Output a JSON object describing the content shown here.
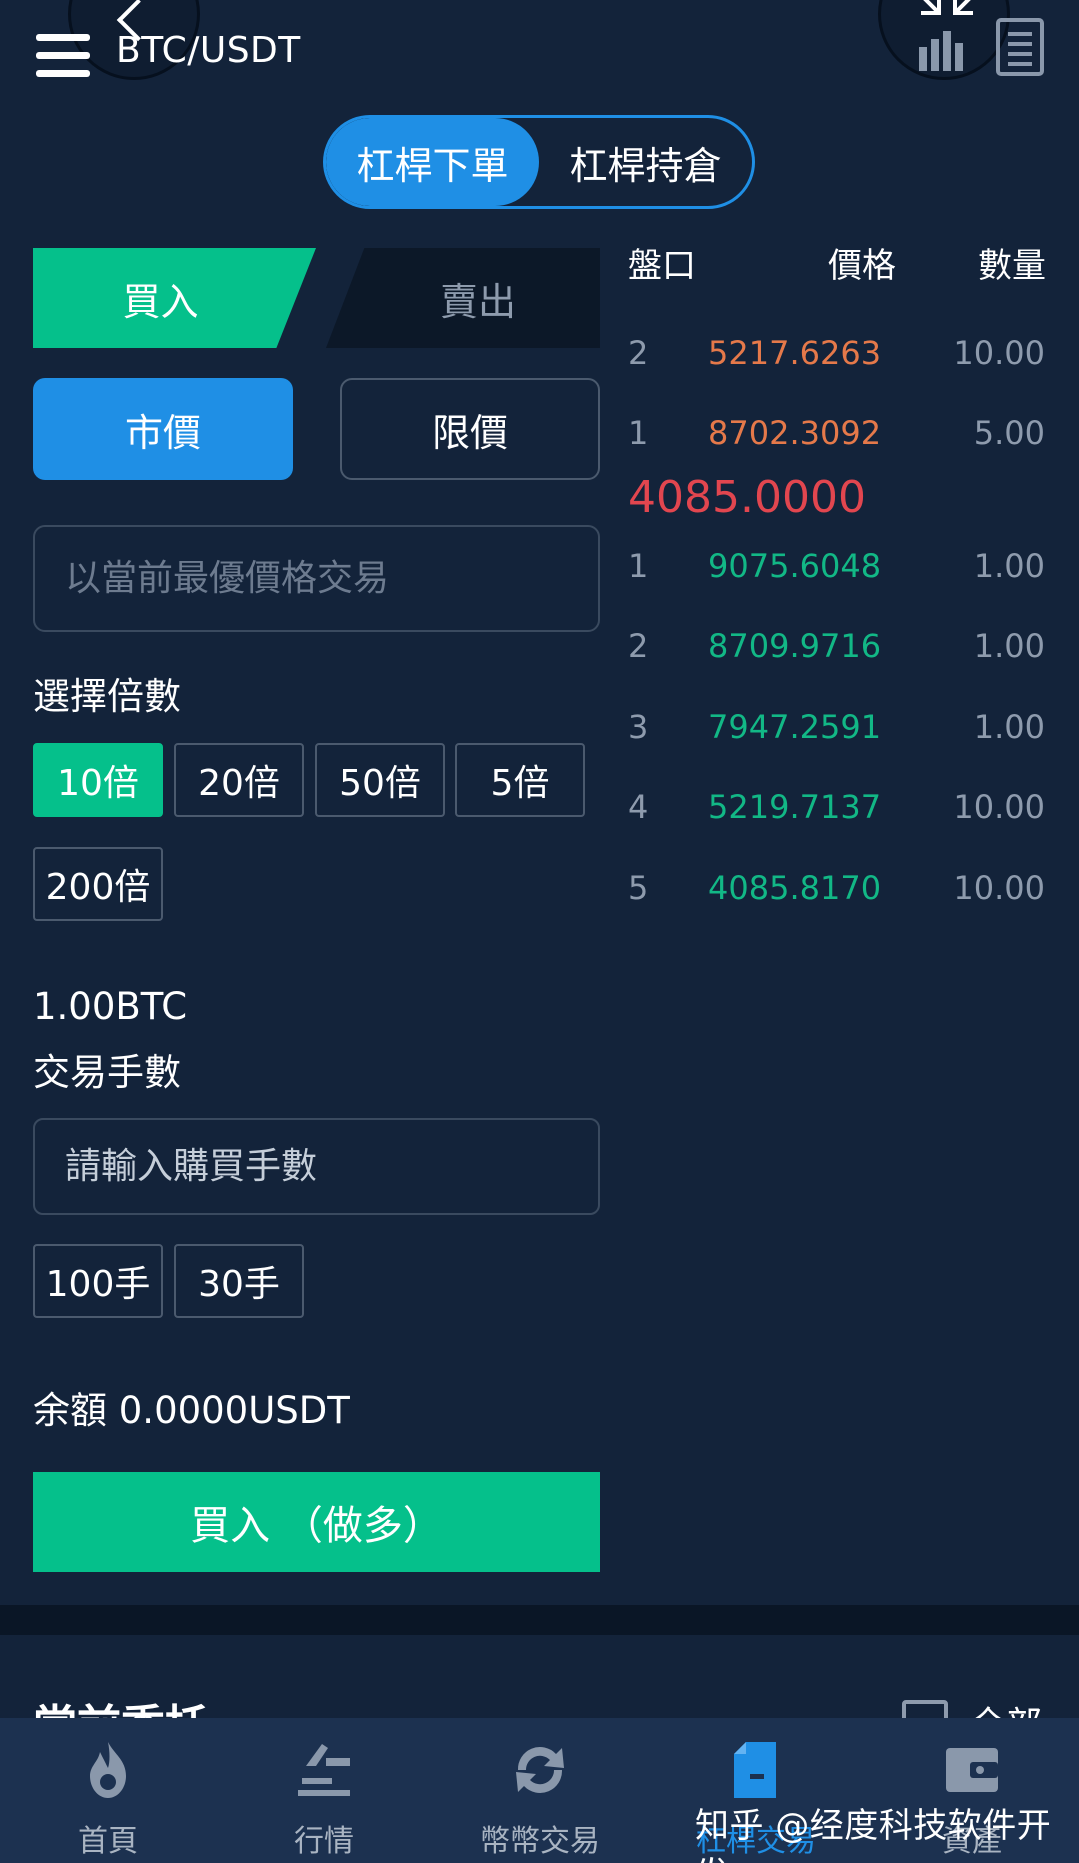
{
  "header": {
    "pair": "BTC/USDT"
  },
  "mode_tabs": {
    "order": "杠桿下單",
    "positions": "杠桿持倉"
  },
  "side_tabs": {
    "buy": "買入",
    "sell": "賣出"
  },
  "order_type": {
    "market": "市價",
    "limit": "限價"
  },
  "price_input": {
    "placeholder": "以當前最優價格交易"
  },
  "leverage": {
    "label": "選擇倍數",
    "options": [
      "10倍",
      "20倍",
      "50倍",
      "5倍",
      "200倍"
    ],
    "selected": "10倍"
  },
  "lot": {
    "unit_value": "1.00BTC",
    "label": "交易手數",
    "placeholder": "請輸入購買手數",
    "quick": [
      "100手",
      "30手"
    ]
  },
  "balance": {
    "text": "余額 0.0000USDT"
  },
  "submit": {
    "label": "買入 （做多）"
  },
  "order_book": {
    "headers": {
      "book": "盤口",
      "price": "價格",
      "qty": "數量"
    },
    "asks": [
      {
        "idx": "2",
        "price": "5217.6263",
        "qty": "10.00"
      },
      {
        "idx": "1",
        "price": "8702.3092",
        "qty": "5.00"
      }
    ],
    "last_price": "4085.0000",
    "bids": [
      {
        "idx": "1",
        "price": "9075.6048",
        "qty": "1.00"
      },
      {
        "idx": "2",
        "price": "8709.9716",
        "qty": "1.00"
      },
      {
        "idx": "3",
        "price": "7947.2591",
        "qty": "1.00"
      },
      {
        "idx": "4",
        "price": "5219.7137",
        "qty": "10.00"
      },
      {
        "idx": "5",
        "price": "4085.8170",
        "qty": "10.00"
      }
    ],
    "colors": {
      "ask": "#e5794a",
      "bid": "#12b886",
      "last": "#e2464f"
    }
  },
  "orders_section": {
    "title": "當前委托",
    "all": "全部"
  },
  "bottom_nav": [
    {
      "label": "首頁",
      "icon": "flame-icon"
    },
    {
      "label": "行情",
      "icon": "chart-icon"
    },
    {
      "label": "幣幣交易",
      "icon": "exchange-icon"
    },
    {
      "label": "杠桿交易",
      "icon": "document-icon"
    },
    {
      "label": "資產",
      "icon": "wallet-icon"
    }
  ],
  "watermark": "知乎 @经度科技软件开发",
  "colors": {
    "background": "#13233a",
    "accent_blue": "#1f8fe5",
    "accent_green": "#05c08b"
  }
}
